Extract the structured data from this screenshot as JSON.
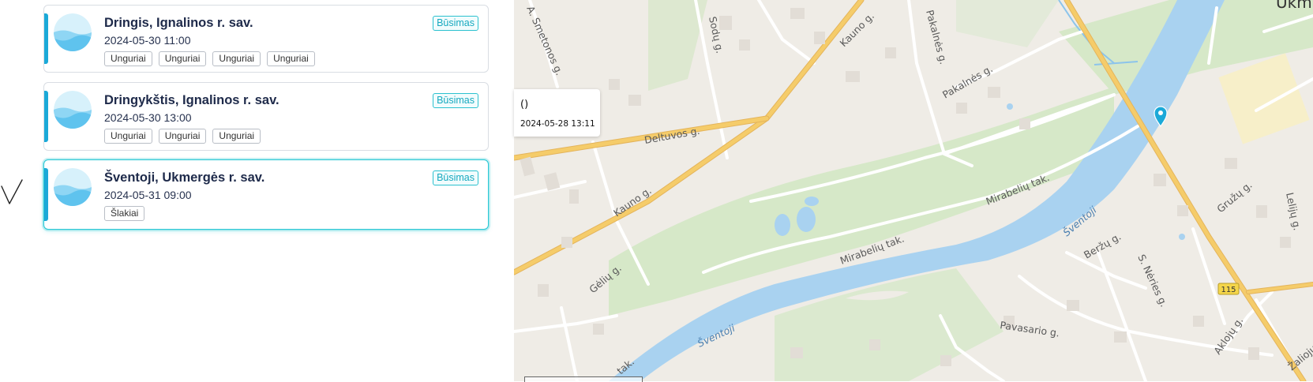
{
  "events": [
    {
      "title": "Dringis, Ignalinos r. sav.",
      "datetime": "2024-05-30 11:00",
      "status": "Būsimas",
      "tags": [
        "Unguriai",
        "Unguriai",
        "Unguriai",
        "Unguriai"
      ]
    },
    {
      "title": "Dringykštis, Ignalinos r. sav.",
      "datetime": "2024-05-30 13:00",
      "status": "Būsimas",
      "tags": [
        "Unguriai",
        "Unguriai",
        "Unguriai"
      ]
    },
    {
      "title": "Šventoji, Ukmergės r. sav.",
      "datetime": "2024-05-31 09:00",
      "status": "Būsimas",
      "tags": [
        "Šlakiai"
      ]
    }
  ],
  "popup": {
    "title": "()",
    "datetime": "2024-05-28 13:11"
  },
  "map": {
    "labels": {
      "smetonos": "A. Smetonos g.",
      "sodu": "Sodų g.",
      "kauno_top": "Kauno g.",
      "pakalnes_v": "Pakalnės g.",
      "pakalnes": "Pakalnės g.",
      "deltuvos": "Deltuvos g.",
      "kauno_bottom": "Kauno g.",
      "mirabeliu_upper": "Mirabelių tak.",
      "mirabeliu_lower": "Mirabelių tak.",
      "sventoji_upper": "Šventoji",
      "sventoji_lower": "Šventoji",
      "geliu": "Gėlių g.",
      "beržu": "Beržų g.",
      "neries": "S. Nėries g.",
      "pavasario": "Pavasario g.",
      "gružu": "Gružų g.",
      "leliju": "Lelijų g.",
      "akliuju": "Aklojų g.",
      "zaliuju": "Žaliojų",
      "tak": "tak.",
      "town": "Ukm",
      "road_number": "115"
    },
    "colors": {
      "land": "#efece6",
      "green": "#d6e8c8",
      "water": "#a9d2f0",
      "major_road": "#f5cc6a",
      "marker": "#1ba9d8"
    }
  }
}
